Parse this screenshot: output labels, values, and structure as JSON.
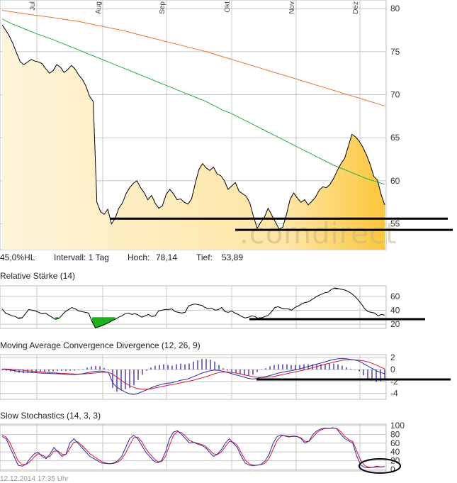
{
  "info": {
    "range_label": "45,0%HL",
    "interval": "Intervall: 1 Tag",
    "high_label": "Hoch:",
    "high_value": "78,14",
    "low_label": "Tief:",
    "low_value": "53,89"
  },
  "watermark": ".comdirect",
  "timestamp": "12.12.2014 17:35 Uhr",
  "colors": {
    "price_fill_light": "#fdf1cf",
    "price_fill_dark": "#fcc63a",
    "sma_long": "#e8742a",
    "sma_short": "#22b43c",
    "rsi_low": "#18b418",
    "rsi_high": "#e01818",
    "macd_line": "#2a2aa8",
    "signal_line": "#d81830",
    "histogram": "#4a40a8"
  },
  "chart_data": [
    {
      "type": "line",
      "name": "price",
      "months": [
        "Jul",
        "Aug",
        "Sep",
        "Okt",
        "Nov",
        "Dez"
      ],
      "ylim": [
        52,
        81
      ],
      "yticks": [
        55,
        60,
        65,
        70,
        75,
        80
      ],
      "price": [
        78.1,
        77.5,
        76.8,
        75.9,
        74.8,
        73.8,
        73.5,
        73.8,
        74.1,
        73.9,
        73.8,
        73.6,
        73.0,
        72.5,
        72.8,
        73.5,
        73.2,
        72.6,
        72.9,
        73.4,
        73.0,
        72.3,
        71.8,
        71.0,
        69.8,
        69.2,
        57.5,
        56.4,
        56.1,
        56.7,
        55.0,
        55.6,
        56.8,
        57.4,
        58.5,
        59.2,
        59.7,
        60.0,
        59.2,
        58.6,
        57.8,
        58.3,
        57.4,
        56.8,
        57.1,
        58.4,
        59.0,
        58.5,
        57.8,
        57.9,
        57.5,
        57.3,
        57.9,
        59.7,
        61.3,
        62.0,
        61.5,
        61.2,
        61.6,
        60.8,
        60.6,
        60.0,
        59.0,
        59.4,
        59.8,
        58.8,
        58.5,
        58.2,
        57.4,
        55.8,
        54.5,
        55.2,
        55.8,
        56.8,
        56.0,
        55.2,
        54.4,
        54.6,
        56.0,
        57.8,
        58.6,
        58.0,
        57.5,
        57.8,
        57.2,
        57.6,
        58.1,
        58.9,
        59.3,
        59.2,
        59.6,
        60.3,
        61.2,
        62.0,
        62.6,
        64.0,
        65.4,
        65.1,
        64.6,
        63.9,
        63.0,
        61.9,
        60.5,
        60.1,
        58.4,
        57.2
      ],
      "sma_200": [
        79.8,
        79.65,
        79.5,
        79.35,
        79.2,
        79.1,
        78.95,
        78.8,
        78.65,
        78.5,
        78.3,
        78.1,
        77.9,
        77.7,
        77.5,
        77.25,
        77.0,
        76.75,
        76.5,
        76.25,
        76.0,
        75.75,
        75.5,
        75.25,
        75.0,
        74.7,
        74.4,
        74.1,
        73.8,
        73.5,
        73.2,
        72.9,
        72.6,
        72.3,
        72.0,
        71.7,
        71.4,
        71.1,
        70.8,
        70.5,
        70.2,
        69.9,
        69.6,
        69.3,
        69.0,
        68.7
      ],
      "sma_100": [
        78.8,
        78.3,
        77.9,
        77.5,
        77.1,
        76.75,
        76.4,
        76.0,
        75.6,
        75.2,
        74.8,
        74.4,
        74.0,
        73.6,
        73.2,
        72.8,
        72.4,
        72.0,
        71.6,
        71.2,
        70.8,
        70.4,
        70.0,
        69.6,
        69.2,
        68.7,
        68.2,
        67.8,
        67.3,
        66.8,
        66.3,
        65.8,
        65.3,
        64.8,
        64.3,
        63.8,
        63.3,
        62.8,
        62.3,
        61.8,
        61.4,
        61.0,
        60.6,
        60.2,
        59.9,
        59.6
      ],
      "support_lines": [
        55.6,
        54.3
      ]
    },
    {
      "type": "line",
      "name": "Relative Stärke (14)",
      "ylim": [
        14,
        75
      ],
      "yticks": [
        20,
        40,
        60
      ],
      "oversold": 30,
      "overbought": 70,
      "values": [
        42,
        36,
        34,
        32,
        31,
        28,
        29,
        35,
        41,
        40,
        39,
        37,
        35,
        36,
        33,
        30,
        27,
        28,
        33,
        38,
        41,
        44,
        42,
        39,
        38,
        37,
        36,
        24,
        15,
        16,
        18,
        20,
        22,
        25,
        27,
        30,
        32,
        35,
        36,
        34,
        35,
        33,
        30,
        32,
        34,
        31,
        32,
        39,
        40,
        41,
        41,
        42,
        38,
        37,
        36,
        37,
        46,
        48,
        49,
        48,
        47,
        44,
        42,
        43,
        40,
        41,
        44,
        38,
        37,
        39,
        36,
        34,
        31,
        29,
        30,
        32,
        31,
        28,
        29,
        31,
        33,
        38,
        44,
        45,
        43,
        42,
        42,
        40,
        44,
        46,
        49,
        51,
        52,
        55,
        58,
        61,
        63,
        65,
        66,
        70,
        72,
        71,
        70,
        69,
        67,
        64,
        60,
        55,
        49,
        42,
        38,
        37,
        36,
        32,
        34,
        33
      ]
    },
    {
      "type": "line",
      "name": "Moving Average Convergence Divergence (12, 26, 9)",
      "ylim": [
        -5,
        2.5
      ],
      "yticks": [
        2,
        0,
        -2,
        -4
      ],
      "macd": [
        0.05,
        0.0,
        -0.1,
        -0.2,
        -0.3,
        -0.4,
        -0.45,
        -0.5,
        -0.55,
        -0.6,
        -0.62,
        -0.65,
        -0.7,
        -0.72,
        -0.75,
        -0.8,
        -0.82,
        -0.85,
        -0.8,
        -0.7,
        -0.55,
        -0.4,
        -0.3,
        -0.25,
        -0.35,
        -0.5,
        -2.2,
        -3.0,
        -3.4,
        -3.8,
        -4.1,
        -4.2,
        -4.0,
        -3.7,
        -3.4,
        -3.1,
        -2.8,
        -2.6,
        -2.4,
        -2.3,
        -2.2,
        -2.0,
        -1.8,
        -1.7,
        -1.5,
        -1.2,
        -0.9,
        -0.6,
        -0.4,
        -0.2,
        -0.1,
        -0.15,
        -0.3,
        -0.5,
        -0.7,
        -0.9,
        -1.1,
        -1.3,
        -1.5,
        -1.6,
        -1.5,
        -1.3,
        -1.2,
        -1.0,
        -0.8,
        -0.6,
        -0.45,
        -0.3,
        -0.2,
        -0.05,
        0.1,
        0.3,
        0.5,
        0.7,
        0.9,
        1.1,
        1.3,
        1.5,
        1.7,
        1.8,
        1.85,
        1.8,
        1.7,
        1.6,
        1.4,
        1.0,
        0.6,
        0.2,
        -0.2,
        -0.5,
        -0.7
      ],
      "signal": [
        0.1,
        0.08,
        0.05,
        0.0,
        -0.05,
        -0.12,
        -0.2,
        -0.27,
        -0.33,
        -0.4,
        -0.45,
        -0.5,
        -0.55,
        -0.6,
        -0.64,
        -0.68,
        -0.72,
        -0.75,
        -0.76,
        -0.74,
        -0.7,
        -0.64,
        -0.57,
        -0.5,
        -0.47,
        -0.47,
        -0.8,
        -1.3,
        -1.8,
        -2.3,
        -2.7,
        -3.0,
        -3.2,
        -3.3,
        -3.3,
        -3.25,
        -3.1,
        -2.95,
        -2.8,
        -2.65,
        -2.5,
        -2.4,
        -2.25,
        -2.1,
        -1.95,
        -1.8,
        -1.6,
        -1.4,
        -1.2,
        -0.95,
        -0.7,
        -0.5,
        -0.4,
        -0.42,
        -0.5,
        -0.6,
        -0.75,
        -0.9,
        -1.05,
        -1.2,
        -1.3,
        -1.33,
        -1.3,
        -1.25,
        -1.15,
        -1.0,
        -0.85,
        -0.7,
        -0.55,
        -0.4,
        -0.25,
        -0.1,
        0.1,
        0.3,
        0.5,
        0.7,
        0.9,
        1.05,
        1.25,
        1.4,
        1.55,
        1.62,
        1.65,
        1.62,
        1.55,
        1.45,
        1.3,
        1.05,
        0.75,
        0.4,
        0.1
      ]
    },
    {
      "type": "line",
      "name": "Slow Stochastics (14, 3, 3)",
      "ylim": [
        -3,
        103
      ],
      "yticks": [
        100,
        80,
        60,
        40,
        20,
        0
      ],
      "k": [
        75,
        70,
        50,
        30,
        10,
        8,
        12,
        25,
        35,
        40,
        30,
        25,
        35,
        50,
        40,
        30,
        35,
        60,
        70,
        60,
        50,
        40,
        30,
        25,
        20,
        15,
        14,
        13,
        15,
        20,
        30,
        50,
        70,
        78,
        70,
        55,
        40,
        30,
        20,
        15,
        20,
        40,
        70,
        85,
        88,
        80,
        70,
        60,
        62,
        58,
        55,
        50,
        40,
        30,
        35,
        45,
        60,
        70,
        60,
        50,
        30,
        15,
        10,
        9,
        10,
        12,
        20,
        35,
        60,
        75,
        78,
        76,
        74,
        76,
        75,
        70,
        60,
        65,
        80,
        88,
        92,
        94,
        93,
        95,
        92,
        80,
        70,
        65,
        60,
        30,
        10,
        5,
        4,
        5,
        8,
        6,
        7
      ],
      "d": [
        78,
        74,
        60,
        40,
        20,
        12,
        12,
        18,
        28,
        36,
        33,
        28,
        30,
        42,
        42,
        35,
        34,
        48,
        62,
        63,
        55,
        46,
        36,
        30,
        24,
        18,
        15,
        13,
        14,
        17,
        24,
        38,
        56,
        72,
        74,
        64,
        48,
        36,
        26,
        18,
        18,
        30,
        55,
        78,
        86,
        84,
        76,
        66,
        62,
        60,
        57,
        53,
        45,
        36,
        34,
        40,
        52,
        64,
        62,
        55,
        38,
        22,
        13,
        10,
        10,
        11,
        15,
        26,
        46,
        66,
        76,
        77,
        75,
        75,
        75,
        72,
        64,
        64,
        74,
        84,
        90,
        93,
        93,
        94,
        93,
        86,
        75,
        68,
        63,
        42,
        20,
        9,
        5,
        5,
        6,
        6,
        7
      ]
    }
  ]
}
